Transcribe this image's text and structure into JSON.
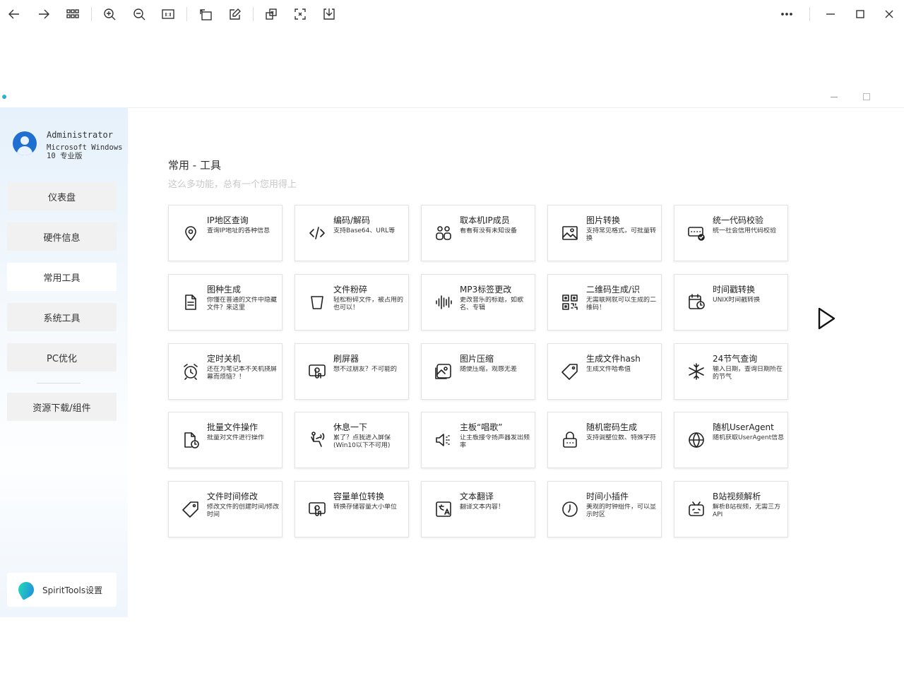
{
  "viewer": {
    "tools": [
      "back-arrow-icon",
      "forward-arrow-icon",
      "grid-view-icon",
      "zoom-in-icon",
      "zoom-out-icon",
      "actual-size-icon",
      "rotate-icon",
      "edit-icon",
      "crop-icon",
      "ocr-icon",
      "save-icon",
      "more-icon"
    ]
  },
  "user": {
    "name": "Administrator",
    "os": "Microsoft Windows 10 专业版"
  },
  "nav": {
    "dashboard": "仪表盘",
    "hardware": "硬件信息",
    "common_tools": "常用工具",
    "system_tools": "系统工具",
    "pc_optimize": "PC优化",
    "downloads": "资源下载/组件",
    "settings": "SpiritTools设置"
  },
  "section": {
    "title": "常用 - 工具",
    "subtitle": "这么多功能，总有一个您用得上"
  },
  "tools": [
    {
      "name": "IP地区查询",
      "desc": "查询IP地址的各种信息",
      "icon": "location-pin-icon"
    },
    {
      "name": "编码/解码",
      "desc": "支持Base64、URL等",
      "icon": "code-icon"
    },
    {
      "name": "取本机IP成员",
      "desc": "看看有没有未知设备",
      "icon": "users-icon"
    },
    {
      "name": "图片转换",
      "desc": "支持常见格式，可批量转换",
      "icon": "image-icon"
    },
    {
      "name": "统一代码校验",
      "desc": "统一社会信用代码校验",
      "icon": "code-check-icon"
    },
    {
      "name": "图种生成",
      "desc": "你懂在普通的文件中隐藏文件？来这里",
      "icon": "document-icon"
    },
    {
      "name": "文件粉碎",
      "desc": "轻松粉碎文件，被占用的也可以！",
      "icon": "trash-bin-icon"
    },
    {
      "name": "MP3标签更改",
      "desc": "更改音乐的标题，如歌名、专辑",
      "icon": "audio-wave-icon"
    },
    {
      "name": "二维码生成/识",
      "desc": "无需联网就可以生成的二维码！",
      "icon": "qr-code-icon"
    },
    {
      "name": "时间戳转换",
      "desc": "UNIX时间戳转换",
      "icon": "calendar-clock-icon"
    },
    {
      "name": "定时关机",
      "desc": "还在为笔记本不关机挠屏幕而烦恼？！",
      "icon": "alarm-clock-icon"
    },
    {
      "name": "刷屏器",
      "desc": "想不过朋友？不可能的",
      "icon": "screen-touch-icon"
    },
    {
      "name": "图片压缩",
      "desc": "随便压缩，观感无差",
      "icon": "image-compress-icon"
    },
    {
      "name": "生成文件hash",
      "desc": "生成文件哈希值",
      "icon": "tag-icon"
    },
    {
      "name": "24节气查询",
      "desc": "输入日期，查询日期所在的节气",
      "icon": "snowflake-icon"
    },
    {
      "name": "批量文件操作",
      "desc": "批量对文件进行操作",
      "icon": "file-clock-icon"
    },
    {
      "name": "休息一下",
      "desc": "累了？点我进入屏保(Win10以下不可用)",
      "icon": "person-relax-icon"
    },
    {
      "name": "主板“唱歌”",
      "desc": "让主板接令扬声器发出频率",
      "icon": "speaker-icon"
    },
    {
      "name": "随机密码生成",
      "desc": "支持调整位数、特殊字符",
      "icon": "lock-icon"
    },
    {
      "name": "随机UserAgent",
      "desc": "随机获取UserAgent信息",
      "icon": "globe-icon"
    },
    {
      "name": "文件时间修改",
      "desc": "修改文件的创建时间/修改时间",
      "icon": "tag-icon"
    },
    {
      "name": "容量单位转换",
      "desc": "转换存储容量大小单位",
      "icon": "screen-touch-icon"
    },
    {
      "name": "文本翻译",
      "desc": "翻译文本内容！",
      "icon": "translate-icon"
    },
    {
      "name": "时间小插件",
      "desc": "美观的时钟组件，可以显示时区",
      "icon": "clock-icon"
    },
    {
      "name": "B站视频解析",
      "desc": "解析B站视频，无需三方API",
      "icon": "tv-icon"
    }
  ]
}
